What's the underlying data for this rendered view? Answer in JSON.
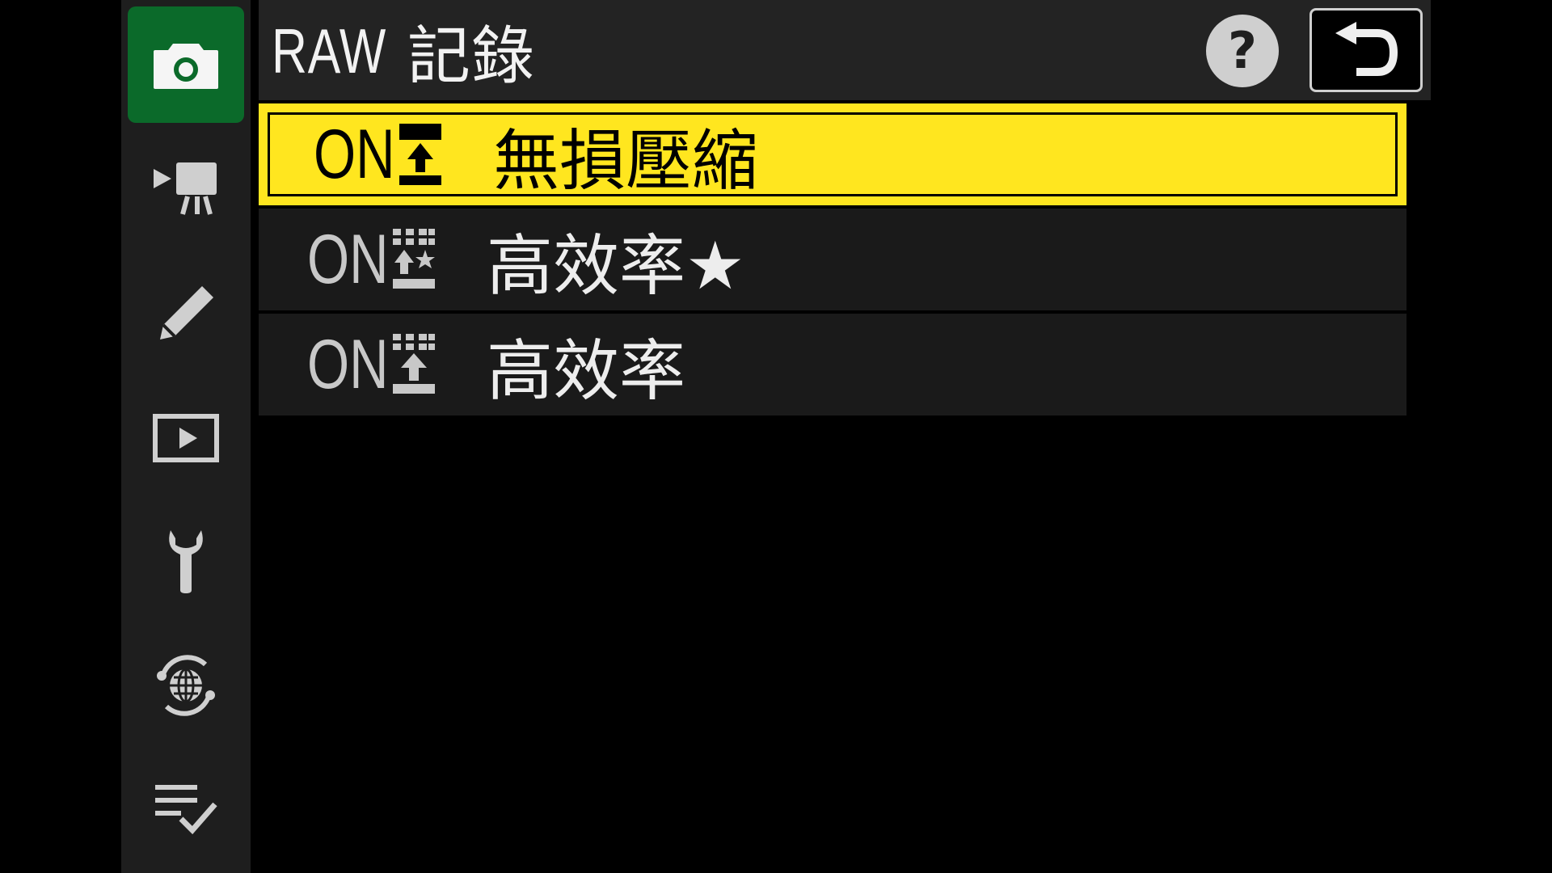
{
  "header": {
    "title_prefix": "RAW",
    "title_main": "記錄",
    "help_label": "?"
  },
  "sidebar": {
    "items": [
      {
        "icon": "camera-icon",
        "active": true
      },
      {
        "icon": "movie-camera-icon",
        "active": false
      },
      {
        "icon": "pencil-icon",
        "active": false
      },
      {
        "icon": "playback-icon",
        "active": false
      },
      {
        "icon": "wrench-icon",
        "active": false
      },
      {
        "icon": "network-globe-icon",
        "active": false
      },
      {
        "icon": "checklist-icon",
        "active": false
      }
    ]
  },
  "options": [
    {
      "code": "ON",
      "label": "無損壓縮",
      "selected": true
    },
    {
      "code": "ON",
      "label": "高效率★",
      "selected": false
    },
    {
      "code": "ON",
      "label": "高效率",
      "selected": false
    }
  ],
  "colors": {
    "accent_selected": "#ffe61f",
    "active_tab": "#0b6a2a",
    "sidebar_bg": "#1e1e1e",
    "row_bg": "#1a1a1a"
  }
}
